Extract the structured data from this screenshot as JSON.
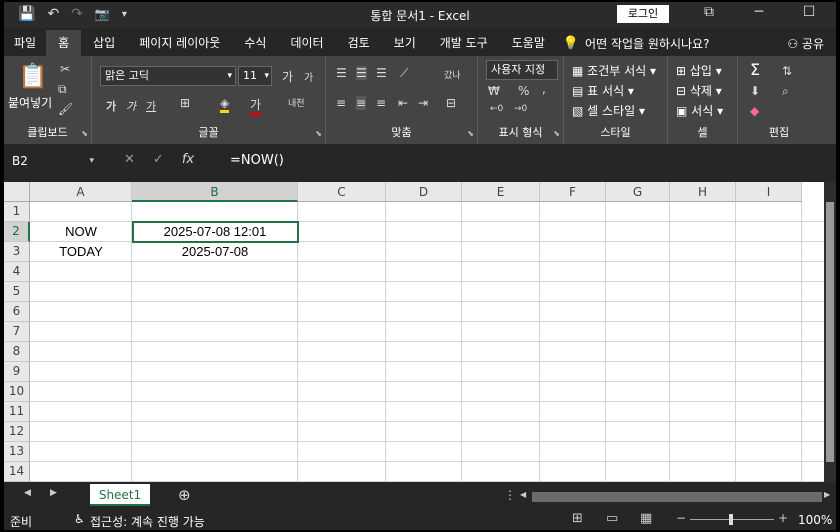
{
  "titlebar": {
    "title": "통합 문서1  -  Excel",
    "login_label": "로그인",
    "qat": {
      "save": "💾",
      "undo": "↶",
      "redo": "↷",
      "camera": "📷",
      "more": "▾"
    },
    "win": {
      "ribbon_opts": "⧉",
      "minimize": "─",
      "maximize": "☐",
      "close": "✕"
    }
  },
  "tabs": [
    "파일",
    "홈",
    "삽입",
    "페이지 레이아웃",
    "수식",
    "데이터",
    "검토",
    "보기",
    "개발 도구",
    "도움말"
  ],
  "tellme": "어떤 작업을 원하시나요?",
  "share": "공유",
  "ribbon": {
    "clipboard": {
      "label": "클립보드",
      "paste": "붙여넣기"
    },
    "font": {
      "label": "글꼴",
      "family": "맑은 고딕",
      "size": "11",
      "bold": "가",
      "italic": "가",
      "underline": "가",
      "grow": "가",
      "shrink": "가",
      "fontcolor": "가",
      "phonetic": "내천"
    },
    "align": {
      "label": "맞춤",
      "wrap": "갔나"
    },
    "number": {
      "label": "표시 형식",
      "format": "사용자 지정",
      "pct": "%",
      "comma": ","
    },
    "styles": {
      "label": "스타일",
      "cond": "조건부 서식",
      "table": "표 서식",
      "cell": "셀 스타일"
    },
    "cells": {
      "label": "셀",
      "insert": "삽입",
      "delete": "삭제",
      "format": "서식"
    },
    "editing": {
      "label": "편집",
      "sum": "Σ"
    }
  },
  "formula_bar": {
    "name_box": "B2",
    "cancel": "✕",
    "enter": "✓",
    "fx": "fx",
    "formula": "=NOW()"
  },
  "columns": [
    "A",
    "B",
    "C",
    "D",
    "E",
    "F",
    "G",
    "H",
    "I"
  ],
  "rows": [
    "1",
    "2",
    "3",
    "4",
    "5",
    "6",
    "7",
    "8",
    "9",
    "10",
    "11",
    "12",
    "13",
    "14"
  ],
  "cells": {
    "A2": "NOW",
    "B2": "2025-07-08 12:01",
    "A3": "TODAY",
    "B3": "2025-07-08"
  },
  "sheet": {
    "name": "Sheet1",
    "add": "⊕"
  },
  "status": {
    "ready": "준비",
    "accessibility": "접근성: 계속 진행 가능",
    "zoom": "100%"
  }
}
